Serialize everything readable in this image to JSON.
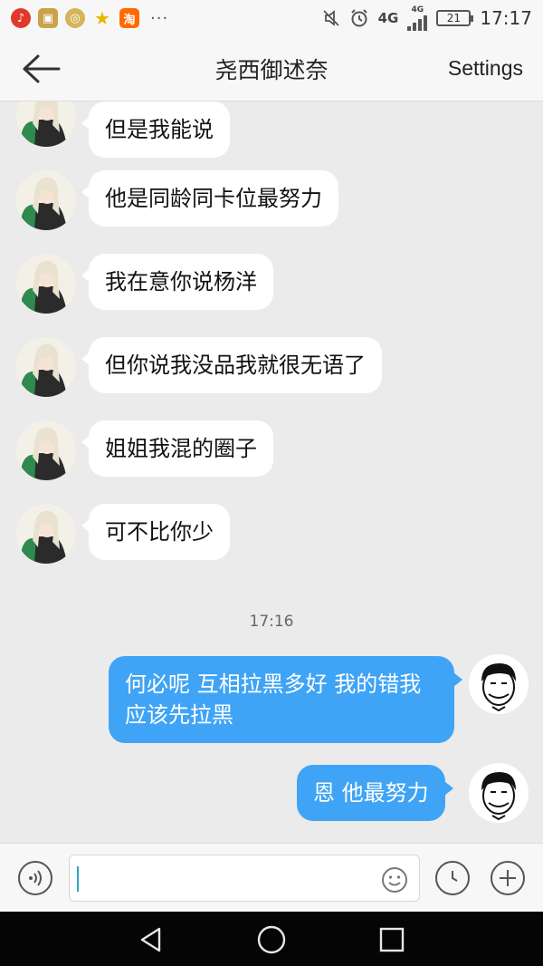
{
  "status_bar": {
    "battery_level": "21",
    "network": "4G",
    "network_small": "4G",
    "time": "17:17",
    "app_icons": [
      "netease-music-icon",
      "gallery-icon",
      "wallet-icon",
      "star-icon",
      "taobao-icon"
    ],
    "taobao_glyph": "淘",
    "more": "···"
  },
  "header": {
    "title": "尧西御述奈",
    "settings_label": "Settings"
  },
  "messages": [
    {
      "side": "left",
      "text": "但是我能说"
    },
    {
      "side": "left",
      "text": "他是同龄同卡位最努力"
    },
    {
      "side": "left",
      "text": "我在意你说杨洋"
    },
    {
      "side": "left",
      "text": "但你说我没品我就很无语了"
    },
    {
      "side": "left",
      "text": "姐姐我混的圈子"
    },
    {
      "side": "left",
      "text": "可不比你少"
    },
    {
      "side": "right",
      "text": "何必呢 互相拉黑多好 我的错我应该先拉黑"
    },
    {
      "side": "right",
      "text": "恩 他最努力"
    }
  ],
  "timestamp": "17:16",
  "input": {
    "placeholder": "",
    "value": ""
  },
  "colors": {
    "sent_bubble": "#3fa4f5",
    "received_bubble": "#ffffff",
    "chat_background": "#ebebeb",
    "cursor": "#2aa6c7"
  }
}
